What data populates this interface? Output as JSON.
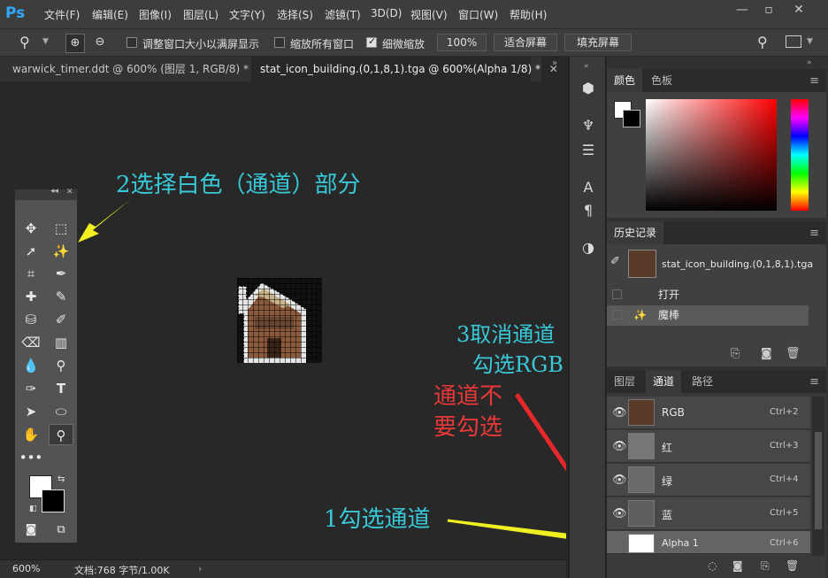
{
  "app": {
    "logo": "Ps"
  },
  "menu": [
    "文件(F)",
    "编辑(E)",
    "图像(I)",
    "图层(L)",
    "文字(Y)",
    "选择(S)",
    "滤镜(T)",
    "3D(D)",
    "视图(V)",
    "窗口(W)",
    "帮助(H)"
  ],
  "options": {
    "resize_windows": "调整窗口大小以满屏显示",
    "zoom_all": "缩放所有窗口",
    "scrubby": "细微缩放",
    "zoom_value": "100%",
    "fit_screen": "适合屏幕",
    "fill_screen": "填充屏幕"
  },
  "tabs": [
    {
      "label": "warwick_timer.ddt @ 600% (图层 1, RGB/8) *"
    },
    {
      "label": "stat_icon_building.(0,1,8,1).tga @ 600%(Alpha 1/8) *"
    }
  ],
  "status": {
    "zoom": "600%",
    "doc": "文档:768 字节/1.00K"
  },
  "color_panel": {
    "tabs": [
      "颜色",
      "色板"
    ]
  },
  "history_panel": {
    "title": "历史记录",
    "snapshot": "stat_icon_building.(0,1,8,1).tga",
    "items": [
      "打开",
      "魔棒"
    ]
  },
  "channels_panel": {
    "tabs": [
      "图层",
      "通道",
      "路径"
    ],
    "channels": [
      {
        "name": "RGB",
        "key": "Ctrl+2"
      },
      {
        "name": "红",
        "key": "Ctrl+3"
      },
      {
        "name": "绿",
        "key": "Ctrl+4"
      },
      {
        "name": "蓝",
        "key": "Ctrl+5"
      },
      {
        "name": "Alpha 1",
        "key": "Ctrl+6"
      }
    ]
  },
  "annotations": {
    "a1": "2选择白色（通道）部分",
    "a2": "3取消通道",
    "a3": "勾选RGB",
    "a4": "通道不",
    "a5": "要勾选",
    "a6": "1勾选通道"
  },
  "colors": {
    "annotation_cyan": "#38c8d8",
    "annotation_red": "#e83838",
    "arrow_yellow": "#f0f020",
    "arrow_blue": "#3050e0",
    "arrow_red": "#e82828"
  }
}
